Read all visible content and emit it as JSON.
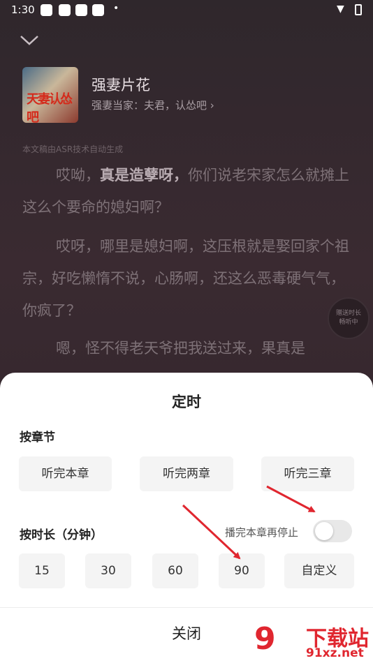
{
  "status_bar": {
    "time": "1:30",
    "dot": "•",
    "wifi": "▼"
  },
  "header": {
    "collapse_icon": "chevron-down-icon"
  },
  "book": {
    "title": "强妻片花",
    "subtitle": "强妻当家：夫君，认怂吧 ›",
    "cover_text": "天妻认怂吧"
  },
  "transcript": {
    "asr_note": "本文稿由ASR技术自动生成",
    "p1_a": "哎呦，",
    "p1_bold": "真是造孽呀，",
    "p1_b": "你们说老宋家怎么就摊上这么个要命的媳妇啊？",
    "p2": "哎呀，哪里是媳妇啊，这压根就是娶回家个祖宗，好吃懒惰不说，心肠啊，还这么恶毒硬气气，你疯了？",
    "p3": "嗯，怪不得老天爷把我送过来，果真是"
  },
  "float_badge": {
    "line1": "赠送时长",
    "line2": "畅听中"
  },
  "timer_sheet": {
    "title": "定时",
    "by_chapter_label": "按章节",
    "chapter_options": [
      "听完本章",
      "听完两章",
      "听完三章"
    ],
    "by_duration_label": "按时长（分钟）",
    "stop_after_chapter_label": "播完本章再停止",
    "stop_after_chapter_on": false,
    "duration_options": [
      "15",
      "30",
      "60",
      "90",
      "自定义"
    ],
    "close_label": "关闭"
  },
  "watermark": {
    "logo": "9",
    "brand": "下载站",
    "url": "91xz.net"
  },
  "colors": {
    "arrow": "#e0262f",
    "sheet_bg": "#ffffff",
    "button_bg": "#f4f4f4"
  }
}
